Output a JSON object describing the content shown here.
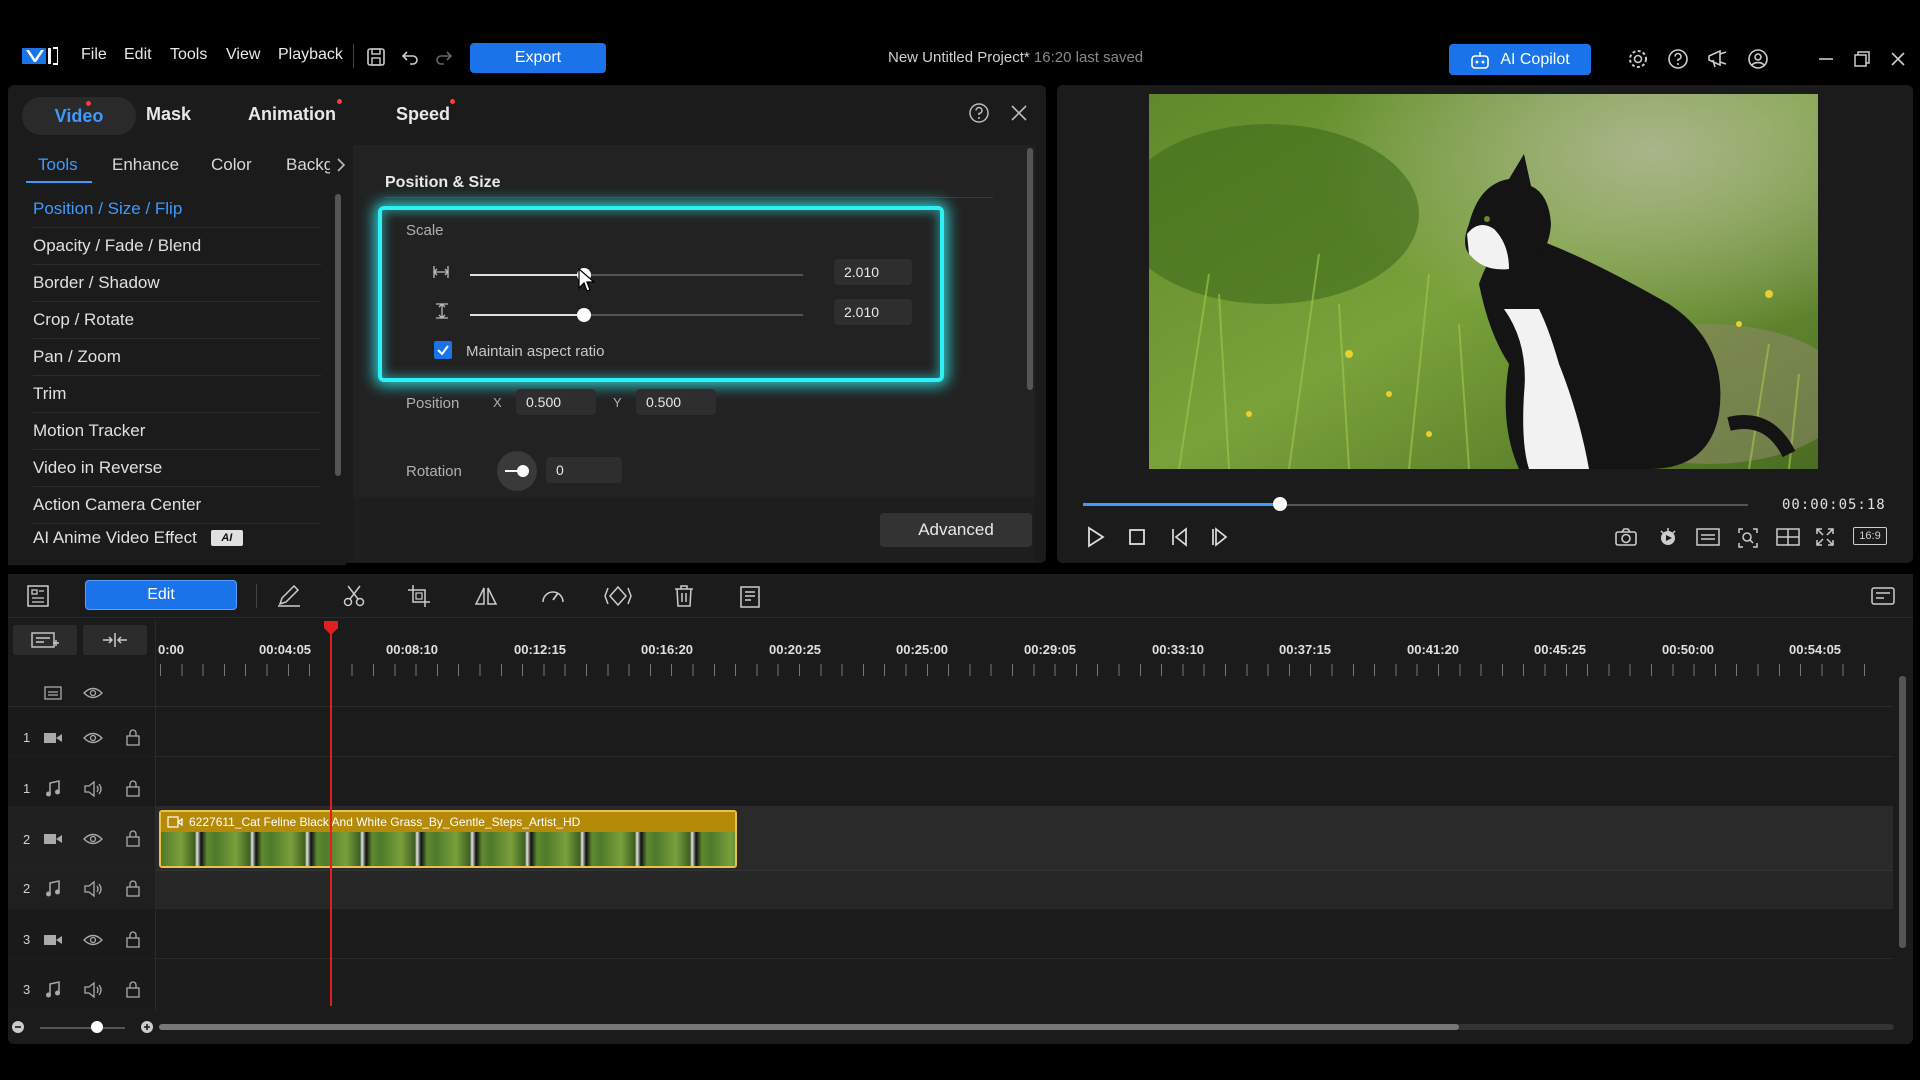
{
  "menu": {
    "file": "File",
    "edit": "Edit",
    "tools": "Tools",
    "view": "View",
    "playback": "Playback",
    "export_label": "Export"
  },
  "project": {
    "title": "New Untitled Project*",
    "saved": "16:20 last saved"
  },
  "copilot_label": "AI Copilot",
  "panel": {
    "tabs": [
      "Video",
      "Mask",
      "Animation",
      "Speed"
    ],
    "subtabs": [
      "Tools",
      "Enhance",
      "Color",
      "Backg"
    ],
    "tools": [
      "Position / Size / Flip",
      "Opacity / Fade / Blend",
      "Border / Shadow",
      "Crop / Rotate",
      "Pan / Zoom",
      "Trim",
      "Motion Tracker",
      "Video in Reverse",
      "Action Camera Center",
      "AI Anime Video Effect"
    ],
    "ai_badge": "AI",
    "section_title": "Position & Size",
    "scale_label": "Scale",
    "scale_width": "2.010",
    "scale_height": "2.010",
    "scale_level": 0.34,
    "maintain_aspect": "Maintain aspect ratio",
    "position_label": "Position",
    "x_label": "X",
    "x_value": "0.500",
    "y_label": "Y",
    "y_value": "0.500",
    "rotation_label": "Rotation",
    "rotation_value": "0",
    "advanced_label": "Advanced"
  },
  "preview": {
    "timecode": "00:00:05:18",
    "progress": 0.3,
    "aspect": "16:9"
  },
  "timeline": {
    "edit_label": "Edit",
    "ruler": [
      "0:00",
      "00:04:05",
      "00:08:10",
      "00:12:15",
      "00:16:20",
      "00:20:25",
      "00:25:00",
      "00:29:05",
      "00:33:10",
      "00:37:15",
      "00:41:20",
      "00:45:25",
      "00:50:00",
      "00:54:05"
    ],
    "track_numbers": [
      "1",
      "1",
      "2",
      "2",
      "3",
      "3"
    ],
    "clip_name": "6227611_Cat Feline Black And White Grass_By_Gentle_Steps_Artist_HD"
  }
}
